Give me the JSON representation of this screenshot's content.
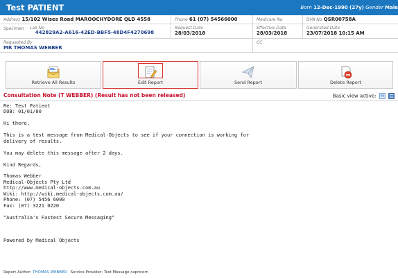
{
  "patient": {
    "name": "Test PATIENT",
    "born_label": "Born",
    "born_value": "12-Dec-1990 (27y)",
    "gender_label": "Gender",
    "gender_value": "Male"
  },
  "info": {
    "address_label": "Address",
    "address_value": "15/102 Wises Road MAROOCHYDORE QLD 4558",
    "phone_label": "Phone",
    "phone_value": "61 (07) 54566000",
    "medicare_label": "Medicare No",
    "medicare_value": "",
    "dva_label": "DVA No",
    "dva_value": "QSR00758A",
    "specimen_label": "Specimen",
    "labno_label": "Lab No",
    "labno_value": "442829A2-A616-42ED-BBF5-48D4F4270698",
    "request_date_label": "Request Date",
    "request_date_value": "28/03/2018",
    "effective_date_label": "Effective Date",
    "effective_date_value": "28/03/2018",
    "generated_date_label": "Generated Date",
    "generated_date_value": "23/07/2018 10:15 AM",
    "requested_by_label": "Requested By",
    "requested_by_value": "MR THOMAS WEBBER",
    "cc_label": "CC",
    "cc_value": ""
  },
  "toolbar": {
    "retrieve_label": "Retrieve All Results",
    "edit_label": "Edit Report",
    "send_label": "Send Report",
    "delete_label": "Delete Report"
  },
  "note": {
    "heading": "Consultation Note (T WEBBER) (Result has not been released)",
    "basic_view_label": "Basic view active:"
  },
  "message": {
    "body": "Re: Test Patient\nDOB: 01/01/80\n\nHi there,\n\nThis is a test message from Medical-Objects to see if your connection is working for\ndelivery of results.\n\nYou may delete this message after 2 days.\n\nKind Regards,\n\nThomas Webber\nMedical-Objects Pty Ltd\nhttp://www.medical-objects.com.au\nWiki: http://wiki.medical-objects.com.au/\nPhone: (07) 5456 6000\nFax: (07) 3221 0220\n\n\"Australia's Fastest Secure Messaging\"\n\n\n\nPowered by Medical Objects"
  },
  "footer": {
    "author_label": "Report Author:",
    "author_value": "THOMAS WEBBER",
    "provider_label": "Service Provider:",
    "provider_value": "Test Message capricorn"
  },
  "colors": {
    "header_blue": "#1b77c0",
    "alert_red": "#c8102e",
    "link_blue": "#1a3f8a"
  }
}
